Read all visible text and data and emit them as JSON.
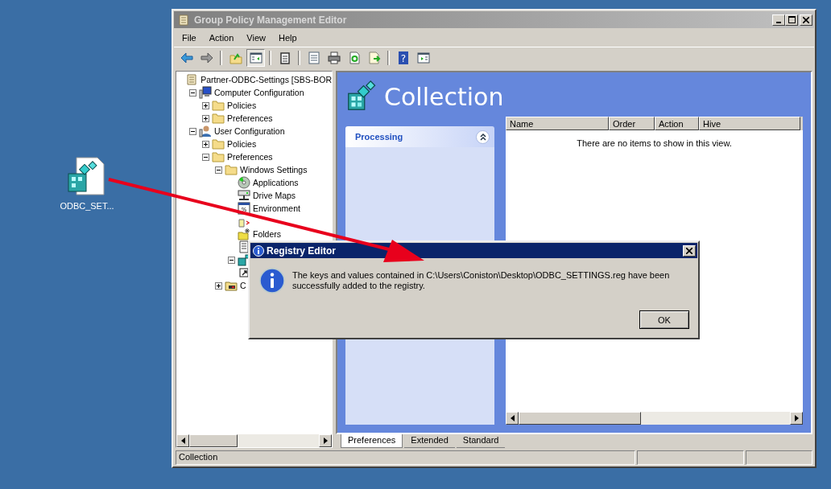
{
  "desktop_icons": [
    {
      "label": "ODBC_SET..."
    }
  ],
  "window": {
    "title": "Group Policy Management Editor",
    "active": false
  },
  "menu": [
    "File",
    "Action",
    "View",
    "Help"
  ],
  "toolbar": [
    {
      "kind": "back",
      "pressed": false
    },
    {
      "kind": "forward",
      "pressed": false
    },
    {
      "kind": "separator"
    },
    {
      "kind": "up",
      "pressed": false
    },
    {
      "kind": "tree",
      "pressed": true
    },
    {
      "kind": "separator"
    },
    {
      "kind": "clipboard",
      "pressed": false
    },
    {
      "kind": "separator"
    },
    {
      "kind": "list",
      "pressed": false
    },
    {
      "kind": "print",
      "pressed": false
    },
    {
      "kind": "refresh",
      "pressed": false
    },
    {
      "kind": "export",
      "pressed": false
    },
    {
      "kind": "separator"
    },
    {
      "kind": "help",
      "pressed": false,
      "glyph": "?"
    },
    {
      "kind": "panel",
      "pressed": false
    }
  ],
  "tree": {
    "label": "Partner-ODBC-Settings [SBS-BOR",
    "kind": "root",
    "children": [
      {
        "label": "Computer Configuration",
        "kind": "computer",
        "expanded": true,
        "children": [
          {
            "label": "Policies",
            "kind": "folder",
            "expanded": false
          },
          {
            "label": "Preferences",
            "kind": "folder",
            "expanded": false
          }
        ]
      },
      {
        "label": "User Configuration",
        "kind": "user",
        "expanded": true,
        "children": [
          {
            "label": "Policies",
            "kind": "folder",
            "expanded": false
          },
          {
            "label": "Preferences",
            "kind": "folder",
            "expanded": true,
            "children": [
              {
                "label": "Windows Settings",
                "kind": "folder",
                "expanded": true,
                "children": [
                  {
                    "label": "Applications",
                    "kind": "applications"
                  },
                  {
                    "label": "Drive Maps",
                    "kind": "drive"
                  },
                  {
                    "label": "Environment",
                    "kind": "environment",
                    "glyph": "%"
                  },
                  {
                    "kind": "files"
                  },
                  {
                    "label": "Folders",
                    "kind": "folders"
                  },
                  {
                    "kind": "ini"
                  },
                  {
                    "kind": "registry",
                    "expanded": true
                  },
                  {
                    "kind": "shortcut"
                  }
                ]
              },
              {
                "label": "C",
                "kind": "control",
                "expanded": false
              }
            ]
          }
        ]
      }
    ]
  },
  "header": {
    "title": "Collection"
  },
  "processing": {
    "title": "Processing",
    "expanded": true
  },
  "table": {
    "columns": [
      "Name",
      "Order",
      "Action",
      "Hive"
    ],
    "empty_message": "There are no items to show in this view."
  },
  "tabs": [
    {
      "label": "Preferences",
      "selected": true
    },
    {
      "label": "Extended",
      "selected": false
    },
    {
      "label": "Standard",
      "selected": false
    }
  ],
  "status_bar": [
    "Collection"
  ],
  "dialog": {
    "title": "Registry Editor",
    "message": "The keys and values contained in C:\\Users\\Coniston\\Desktop\\ODBC_SETTINGS.reg have been successfully added to the registry.",
    "buttons": [
      "OK"
    ]
  }
}
